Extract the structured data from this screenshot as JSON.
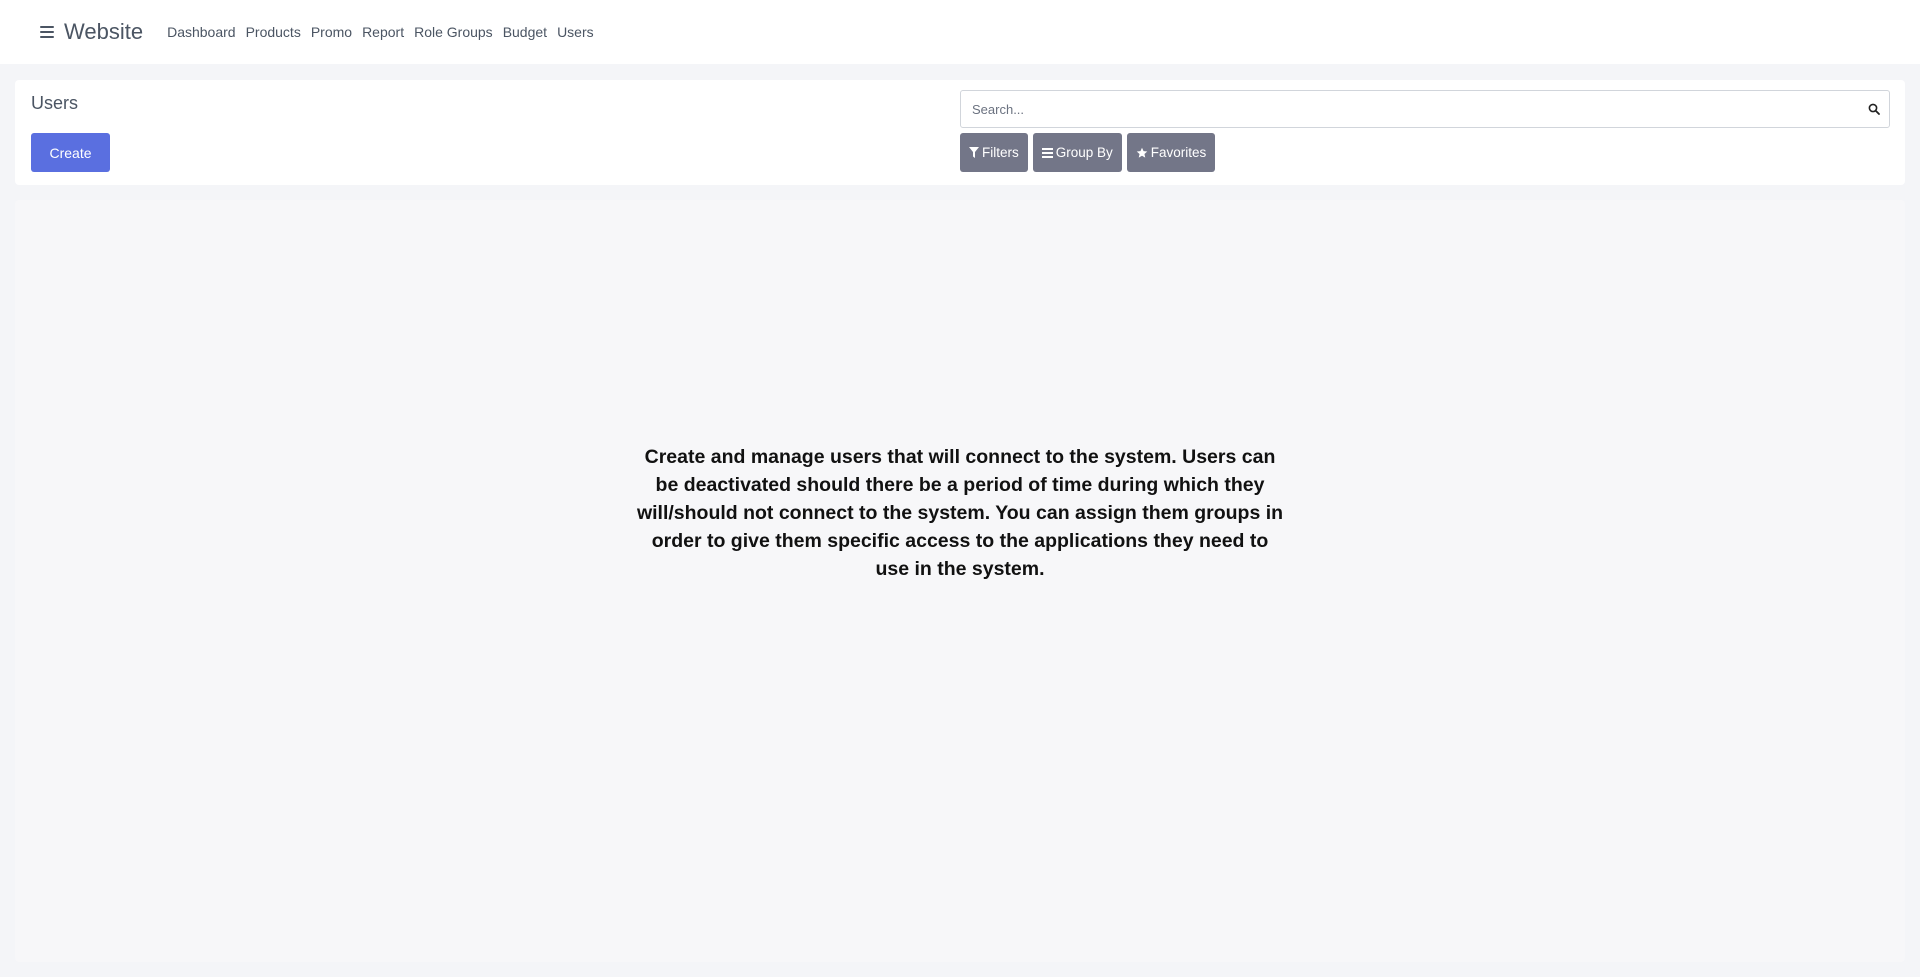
{
  "app": {
    "brand": "Website",
    "nav_items": [
      "Dashboard",
      "Products",
      "Promo",
      "Report",
      "Role Groups",
      "Budget",
      "Users"
    ]
  },
  "control_panel": {
    "title": "Users",
    "create_label": "Create",
    "search_placeholder": "Search...",
    "filters_label": "Filters",
    "group_by_label": "Group By",
    "favorites_label": "Favorites"
  },
  "main": {
    "help_text": "Create and manage users that will connect to the system. Users can be deactivated should there be a period of time during which they will/should not connect to the system. You can assign them groups in order to give them specific access to the applications they need to use in the system."
  },
  "colors": {
    "primary": "#5a6fe0",
    "secondary_button": "#737688",
    "background": "#f4f5f8"
  },
  "icons": [
    "hamburger-icon",
    "search-icon",
    "filter-icon",
    "list-icon",
    "star-icon"
  ]
}
